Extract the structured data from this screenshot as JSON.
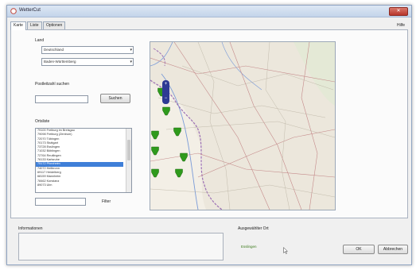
{
  "window": {
    "title": "WetterCut",
    "close_label": "✕"
  },
  "tabs": [
    {
      "label": "Karte",
      "active": true
    },
    {
      "label": "Liste",
      "active": false
    },
    {
      "label": "Optionen",
      "active": false
    }
  ],
  "help_label": "Hilfe",
  "left_panel": {
    "land_label": "Land",
    "country_value": "Deutschland",
    "state_value": "Baden-Württemberg",
    "postal_label": "Postleitzahl suchen",
    "postal_value": "",
    "search_button": "Suchen",
    "places_label": "Ortsliste",
    "places": [
      "79100 Freiburg im Breisgau",
      "79098 Freiburg (Zentrum)",
      "72070 Tübingen",
      "70173 Stuttgart",
      "73728 Esslingen",
      "71032 Böblingen",
      "72764 Reutlingen",
      "76133 Karlsruhe",
      "75172 Pforzheim",
      "74072 Heilbronn",
      "69117 Heidelberg",
      "68159 Mannheim",
      "78462 Konstanz",
      "89073 Ulm"
    ],
    "selected_index": 8,
    "filter_value": "",
    "filter_button": "Filter"
  },
  "map": {
    "zoom_in_label": "+",
    "zoom_out_label": "−",
    "marker_color": "#2f9a1c",
    "markers_count_visible": 15
  },
  "bottom": {
    "info_label": "Informationen",
    "info_value": "",
    "selected_place_label": "Ausgewählter Ort",
    "selected_place_value": "Esslingen",
    "ok_button": "OK",
    "cancel_button": "Abbrechen"
  },
  "colors": {
    "accent": "#3f7fd8",
    "titlebar": "#c3d4ea",
    "close": "#c0443a",
    "map_base": "#ece7dc",
    "marker": "#2f9a1c",
    "border_line": "#9b6fb4"
  }
}
